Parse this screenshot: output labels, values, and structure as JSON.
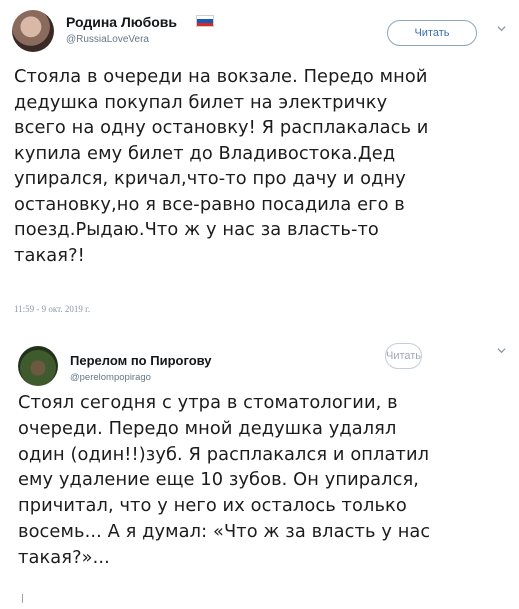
{
  "tweets": [
    {
      "author_name": "Родина Любовь",
      "author_handle": "@RussiaLoveVera",
      "follow_label": "Читать",
      "text": "Стояла в очереди на вокзале. Передо мной\nдедушка покупал билет на электричку\nвсего на одну остановку! Я расплакалась и\nкупила ему билет до Владивостока.Дед\nупирался, кричал,что-то про дачу и одну\nостановку,но я все-равно посадила его в\nпоезд.Рыдаю.Что ж у нас за власть-то\nтакая?!",
      "timestamp": "11:59 - 9 окт. 2019 г."
    },
    {
      "author_name": "Перелом по Пирогову",
      "author_handle": "@perelompopirago",
      "follow_label": "Читать",
      "text": "Стоял сегодня с утра в стоматологии, в\nочереди. Передо мной дедушка удалял\nодин (один!!)зуб. Я расплакался и оплатил\nему удаление еще 10 зубов. Он упирался,\nпричитал, что у него их осталось только\nвосемь... А я думал: «Что ж за власть у нас\nтакая?»..."
    }
  ],
  "colors": {
    "follow_text": "#3b6fa8",
    "handle": "#657786",
    "flag_white": "#ffffff",
    "flag_blue": "#1c56b8",
    "flag_red": "#d52b1e"
  },
  "icons": [
    "avatar",
    "flag-russia-icon",
    "chevron-down-icon"
  ]
}
